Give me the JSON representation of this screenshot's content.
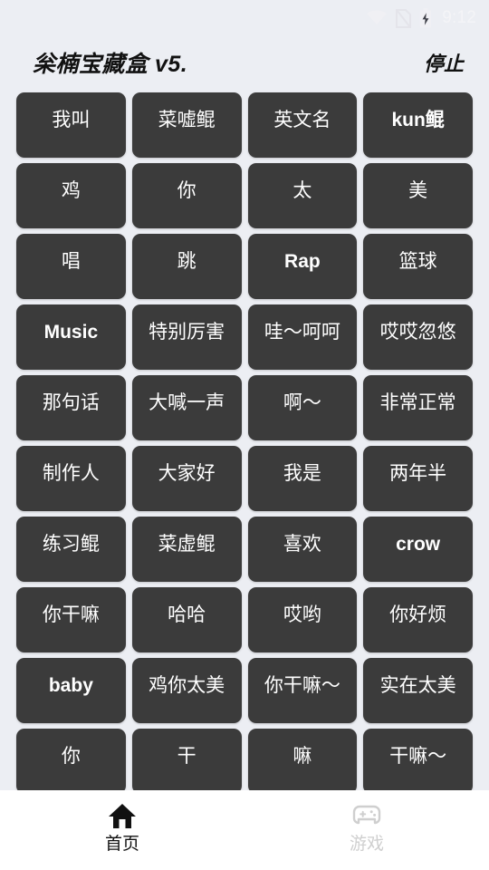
{
  "statusbar": {
    "time": "9:12",
    "icons": [
      "wifi-icon",
      "no-sim-icon",
      "battery-charging-icon"
    ]
  },
  "appbar": {
    "title": "枀楠宝藏盒 v5.",
    "action_label": "停止"
  },
  "grid": {
    "columns": 4,
    "chips": [
      {
        "label": "我叫",
        "latin": false
      },
      {
        "label": "菜嘘鲲",
        "latin": false
      },
      {
        "label": "英文名",
        "latin": false
      },
      {
        "label": "kun鲲",
        "latin": true
      },
      {
        "label": "鸡",
        "latin": false
      },
      {
        "label": "你",
        "latin": false
      },
      {
        "label": "太",
        "latin": false
      },
      {
        "label": "美",
        "latin": false
      },
      {
        "label": "唱",
        "latin": false
      },
      {
        "label": "跳",
        "latin": false
      },
      {
        "label": "Rap",
        "latin": true
      },
      {
        "label": "篮球",
        "latin": false
      },
      {
        "label": "Music",
        "latin": true
      },
      {
        "label": "特别厉害",
        "latin": false
      },
      {
        "label": "哇～呵呵",
        "latin": false
      },
      {
        "label": "哎哎忽悠",
        "latin": false
      },
      {
        "label": "那句话",
        "latin": false
      },
      {
        "label": "大喊一声",
        "latin": false
      },
      {
        "label": "啊～",
        "latin": false
      },
      {
        "label": "非常正常",
        "latin": false
      },
      {
        "label": "制作人",
        "latin": false
      },
      {
        "label": "大家好",
        "latin": false
      },
      {
        "label": "我是",
        "latin": false
      },
      {
        "label": "两年半",
        "latin": false
      },
      {
        "label": "练习鲲",
        "latin": false
      },
      {
        "label": "菜虚鲲",
        "latin": false
      },
      {
        "label": "喜欢",
        "latin": false
      },
      {
        "label": "crow",
        "latin": true
      },
      {
        "label": "你干嘛",
        "latin": false
      },
      {
        "label": "哈哈",
        "latin": false
      },
      {
        "label": "哎哟",
        "latin": false
      },
      {
        "label": "你好烦",
        "latin": false
      },
      {
        "label": "baby",
        "latin": true
      },
      {
        "label": "鸡你太美",
        "latin": false
      },
      {
        "label": "你干嘛～",
        "latin": false
      },
      {
        "label": "实在太美",
        "latin": false
      },
      {
        "label": "你",
        "latin": false
      },
      {
        "label": "干",
        "latin": false
      },
      {
        "label": "嘛",
        "latin": false
      },
      {
        "label": "干嘛～",
        "latin": false
      }
    ]
  },
  "bottomnav": {
    "items": [
      {
        "label": "首页",
        "icon": "home-icon",
        "active": true
      },
      {
        "label": "游戏",
        "icon": "gamepad-icon",
        "active": false
      }
    ]
  },
  "colors": {
    "page_background": "#eceef3",
    "chip_background": "#3b3b3b",
    "chip_text": "#ffffff",
    "nav_background": "#ffffff",
    "nav_active": "#111111",
    "nav_inactive": "#cfcfcf",
    "status_icon": "#f0f0f4"
  }
}
